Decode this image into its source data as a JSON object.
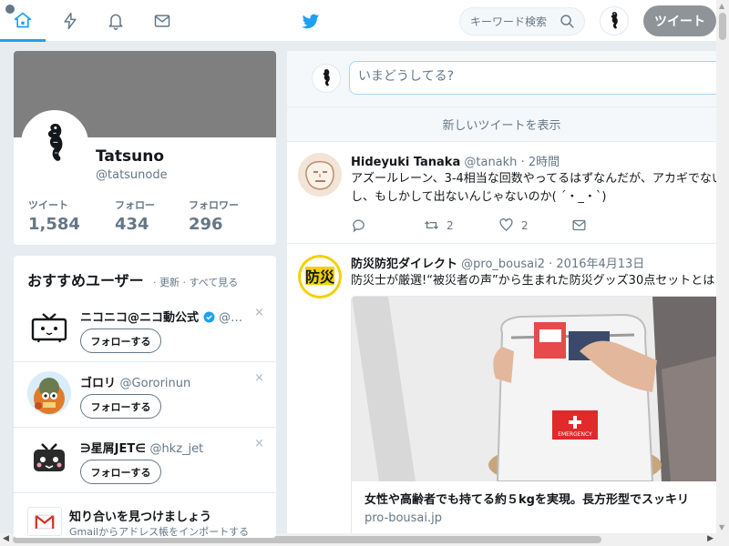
{
  "nav": {
    "search_placeholder": "キーワード検索",
    "tweet_button": "ツイート",
    "accent_color": "#1da1f2"
  },
  "profile": {
    "name": "Tatsuno",
    "handle": "@tatsunode",
    "stats": [
      {
        "label": "ツイート",
        "value": "1,584"
      },
      {
        "label": "フォロー",
        "value": "434"
      },
      {
        "label": "フォロワー",
        "value": "296"
      }
    ]
  },
  "who_to_follow": {
    "title": "おすすめユーザー",
    "links": "· 更新 · すべて見る",
    "follow_label": "フォローする",
    "dismiss": "×",
    "users": [
      {
        "name": "ニコニコ@ニコ動公式",
        "handle": "@…",
        "verified": true
      },
      {
        "name": "ゴロリ",
        "handle": "@Gororinun",
        "verified": false
      },
      {
        "name": "∋星屑JET∈",
        "handle": "@hkz_jet",
        "verified": false
      }
    ],
    "find_friends": {
      "title": "知り合いを見つけましょう",
      "subtitle": "Gmailからアドレス帳をインポートする"
    }
  },
  "composer": {
    "placeholder": "いまどうしてる?"
  },
  "timeline": {
    "new_tweets": "新しいツイートを表示",
    "tweets": [
      {
        "name": "Hideyuki Tanaka",
        "handle": "@tanakh",
        "time": "· 2時間",
        "text": "アズールレーン、3-4相当な回数やってるはずなんだが、アカギでないし、もしかして出ないんじゃないのか( ´・_・`)",
        "replies": "",
        "retweets": "2",
        "likes": "2"
      },
      {
        "name": "防災防犯ダイレクト",
        "handle": "@pro_bousai2",
        "time": "· 2016年4月13日",
        "text": "防災士が厳選!“被災者の声”から生まれた防災グッズ30点セットとは",
        "card_title": "女性や高齢者でも持てる約５kgを実現。長方形型でスッキリ",
        "card_domain": "pro-bousai.jp",
        "card_emergency": "EMERGENCY"
      }
    ]
  }
}
